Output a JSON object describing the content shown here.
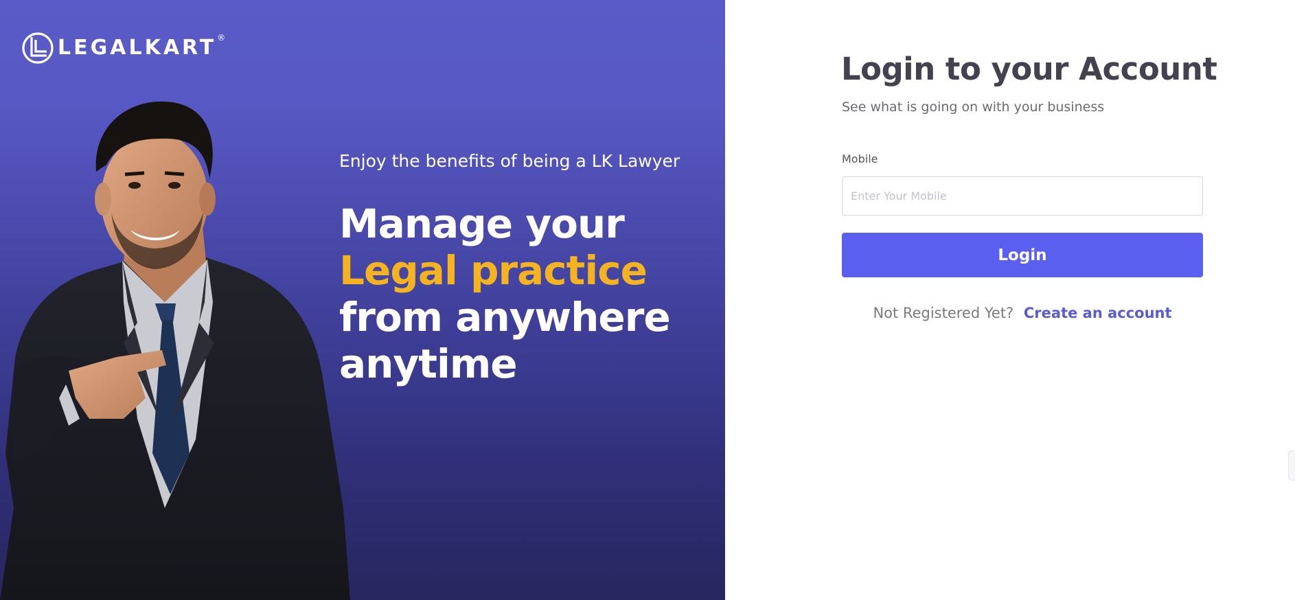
{
  "brand": {
    "name": "LEGALKART",
    "registered_mark": "®",
    "icon": "legalkart-logo-icon"
  },
  "hero": {
    "tagline": "Enjoy the benefits of being a LK Lawyer",
    "headline": {
      "line1": "Manage your",
      "line2_accent": "Legal practice",
      "line3": "from anywhere",
      "line4": "anytime"
    },
    "image": "smiling-lawyer-in-suit-pointing",
    "colors": {
      "accent": "#f5b31f",
      "gradient_top": "#5a5bc8",
      "gradient_bottom": "#27265e"
    }
  },
  "login": {
    "title": "Login to your Account",
    "subtitle": "See what is going on with your business",
    "mobile_label": "Mobile",
    "mobile_placeholder": "Enter Your Mobile",
    "mobile_value": "",
    "login_button": "Login",
    "register_prompt": "Not Registered Yet?",
    "register_link": "Create an account",
    "colors": {
      "button": "#5b5ff0",
      "link": "#5b5ccf",
      "title": "#45424f"
    }
  }
}
